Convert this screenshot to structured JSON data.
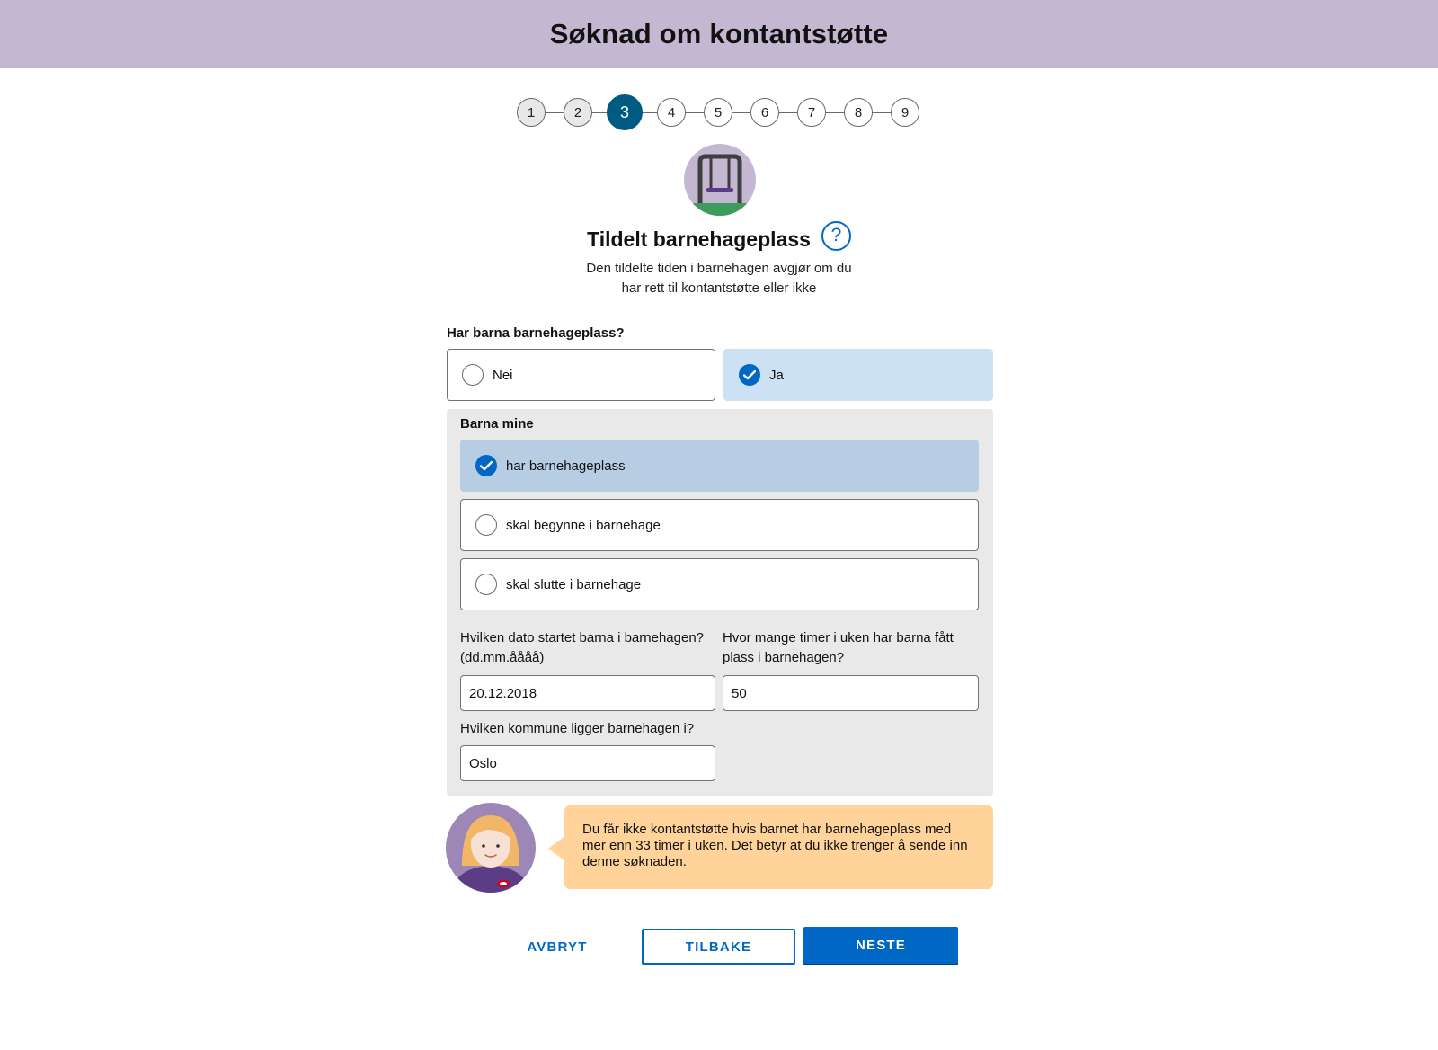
{
  "header": {
    "title": "Søknad om kontantstøtte"
  },
  "stepper": {
    "steps": [
      "1",
      "2",
      "3",
      "4",
      "5",
      "6",
      "7",
      "8",
      "9"
    ],
    "current": 3
  },
  "section": {
    "title": "Tildelt barnehageplass",
    "subtitle_line1": "Den tildelte tiden i barnehagen avgjør om du",
    "subtitle_line2": "har rett til kontantstøtte eller ikke"
  },
  "question": {
    "label": "Har barna barnehageplass?",
    "options": [
      {
        "label": "Nei",
        "selected": false
      },
      {
        "label": "Ja",
        "selected": true
      }
    ]
  },
  "children": {
    "label": "Barna mine",
    "options": [
      {
        "label": "har barnehageplass",
        "selected": true
      },
      {
        "label": "skal begynne i barnehage",
        "selected": false
      },
      {
        "label": "skal slutte i barnehage",
        "selected": false
      }
    ]
  },
  "fields": {
    "start_date_label_1": "Hvilken dato startet barna i barnehagen?",
    "start_date_label_2": "(dd.mm.åååå)",
    "start_date_value": "20.12.2018",
    "hours_label_1": "Hvor mange timer i uken har barna fått",
    "hours_label_2": "plass i barnehagen?",
    "hours_value": "50",
    "municipality_label": "Hvilken kommune ligger barnehagen i?",
    "municipality_value": "Oslo"
  },
  "info": {
    "line1": "Du får ikke kontantstøtte hvis barnet har barnehageplass med",
    "line2": "mer enn 33 timer i uken. Det betyr at du ikke trenger å sende inn",
    "line3": "denne søknaden."
  },
  "buttons": {
    "cancel": "AVBRYT",
    "back": "TILBAKE",
    "next": "NESTE"
  },
  "colors": {
    "header_bg": "#c3b7d1",
    "accent": "#0067c5",
    "step_active": "#005b82",
    "selected_bg": "#cde1f5",
    "panel_bg": "#e9e9e9",
    "info_bg": "#ffd399"
  },
  "icons": {
    "illustration": "swing-icon",
    "help": "question-mark-icon",
    "avatar": "veileder-avatar-icon",
    "check": "checkmark-icon"
  }
}
